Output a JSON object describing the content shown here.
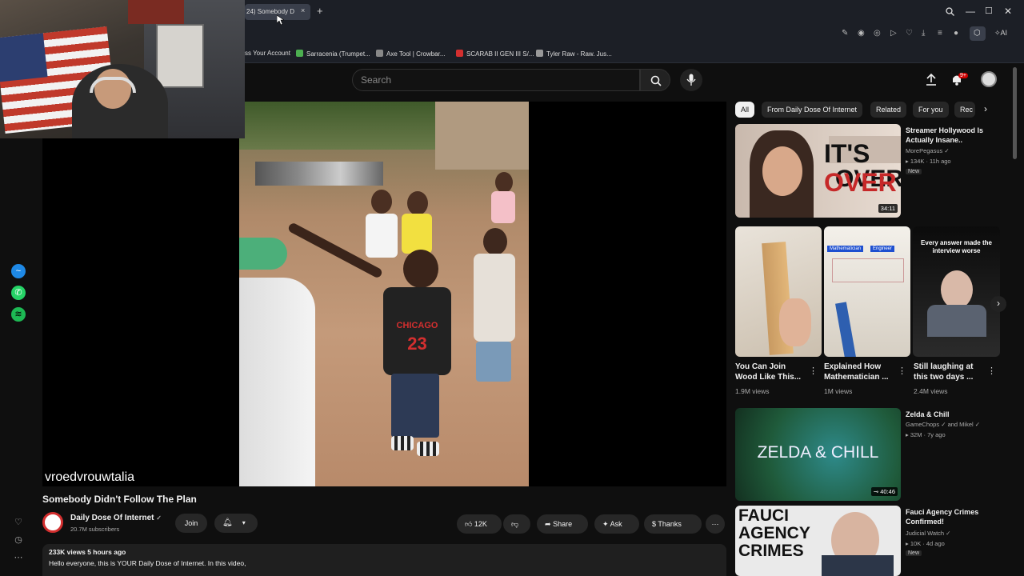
{
  "browser": {
    "tab_title": "24) Somebody D",
    "tab_close": "×",
    "new_tab": "+",
    "bookmarks": [
      {
        "label": "ss Your Account",
        "color": "#1c1f26"
      },
      {
        "label": "Sarracenia (Trumpet...",
        "color": "#4caf50"
      },
      {
        "label": "Axe Tool | Crowbar...",
        "color": "#888888"
      },
      {
        "label": "SCARAB II GEN III S/...",
        "color": "#d32f2f"
      },
      {
        "label": "Tyler Raw - Raw. Jus...",
        "color": "#999999"
      }
    ],
    "ai_label": "AI"
  },
  "header": {
    "search_placeholder": "Search",
    "notif_count": "9+"
  },
  "video": {
    "caption_user": "vroedvrouwtalia",
    "title": "Somebody Didn't Follow The Plan",
    "jersey_text": "CHICAGO",
    "jersey_number": "23"
  },
  "channel": {
    "name": "Daily Dose Of Internet",
    "subscribers": "20.7M subscribers",
    "join_label": "Join"
  },
  "actions": {
    "likes": "12K",
    "share": "Share",
    "ask": "Ask",
    "thanks": "Thanks"
  },
  "description": {
    "views_time": "233K views  5 hours ago",
    "text": "Hello everyone, this is YOUR Daily Dose of Internet. In this video,"
  },
  "chips": [
    "All",
    "From Daily Dose Of Internet",
    "Related",
    "For you",
    "Rec"
  ],
  "recommendations": [
    {
      "title": "Streamer Hollywood Is Actually Insane..",
      "channel": "MorePegasus",
      "meta": "134K · 11h ago",
      "badge": "New",
      "duration": "34:11",
      "thumb_text": "IT'S OVER"
    },
    {
      "title": "Zelda & Chill",
      "channel": "GameChops",
      "channel2": "and Mikel",
      "meta": "32M · 7y ago",
      "duration": "40:46",
      "thumb_text": "ZELDA & CHILL"
    },
    {
      "title": "Fauci Agency Crimes Confirmed!",
      "channel": "Judicial Watch",
      "meta": "10K · 4d ago",
      "badge": "New",
      "thumb_text_1": "FAUCI",
      "thumb_text_2": "AGENCY",
      "thumb_text_3": "CRIMES"
    }
  ],
  "shorts": [
    {
      "title": "You Can Join Wood Like This...",
      "views": "1.9M views"
    },
    {
      "title": "Explained How Mathematician ...",
      "views": "1M views",
      "tag1": "Mathematician",
      "tag2": "Engineer"
    },
    {
      "title": "Still laughing at this two days ...",
      "views": "2.4M views",
      "overlay": "Every answer made the interview worse"
    }
  ]
}
